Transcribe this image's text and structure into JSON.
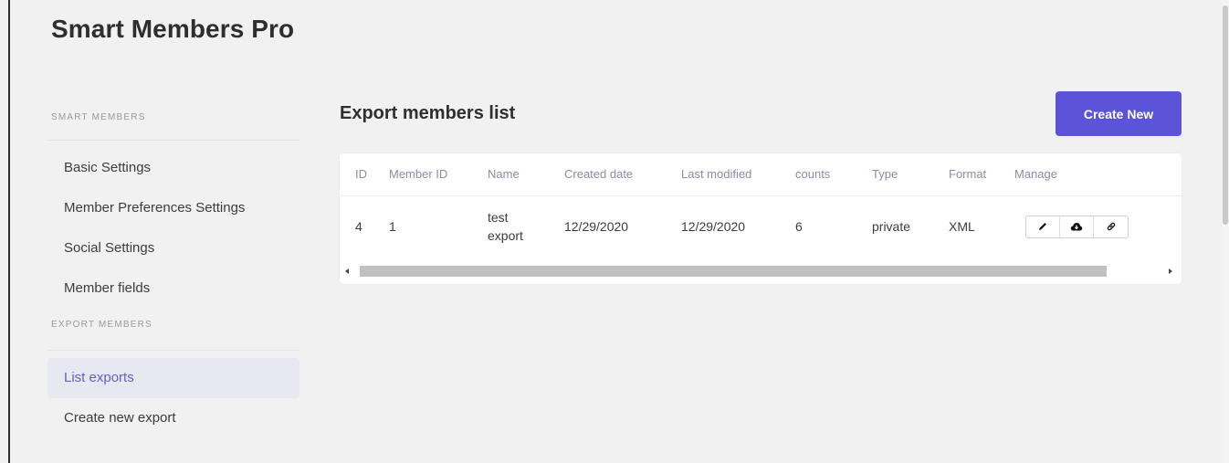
{
  "app": {
    "title": "Smart Members Pro"
  },
  "sidebar": {
    "sections": [
      {
        "heading": "Smart Members",
        "items": [
          {
            "label": "Basic Settings"
          },
          {
            "label": "Member Preferences Settings"
          },
          {
            "label": "Social Settings"
          },
          {
            "label": "Member fields"
          }
        ]
      },
      {
        "heading": "Export Members",
        "items": [
          {
            "label": "List exports",
            "active": true
          },
          {
            "label": "Create new export"
          }
        ]
      }
    ]
  },
  "main": {
    "title": "Export members list",
    "create_button": "Create New",
    "table": {
      "columns": [
        "ID",
        "Member ID",
        "Name",
        "Created date",
        "Last modified",
        "counts",
        "Type",
        "Format",
        "Manage"
      ],
      "rows": [
        {
          "id": "4",
          "member_id": "1",
          "name_line1": "test",
          "name_line2": "export",
          "created": "12/29/2020",
          "modified": "12/29/2020",
          "counts": "6",
          "type": "private",
          "format": "XML",
          "actions": [
            "pencil-icon",
            "cloud-download-icon",
            "link-icon"
          ]
        }
      ]
    }
  },
  "colors": {
    "accent": "#5b54d9",
    "active_text": "#6460c9",
    "active_bg": "#e8e8f1"
  }
}
